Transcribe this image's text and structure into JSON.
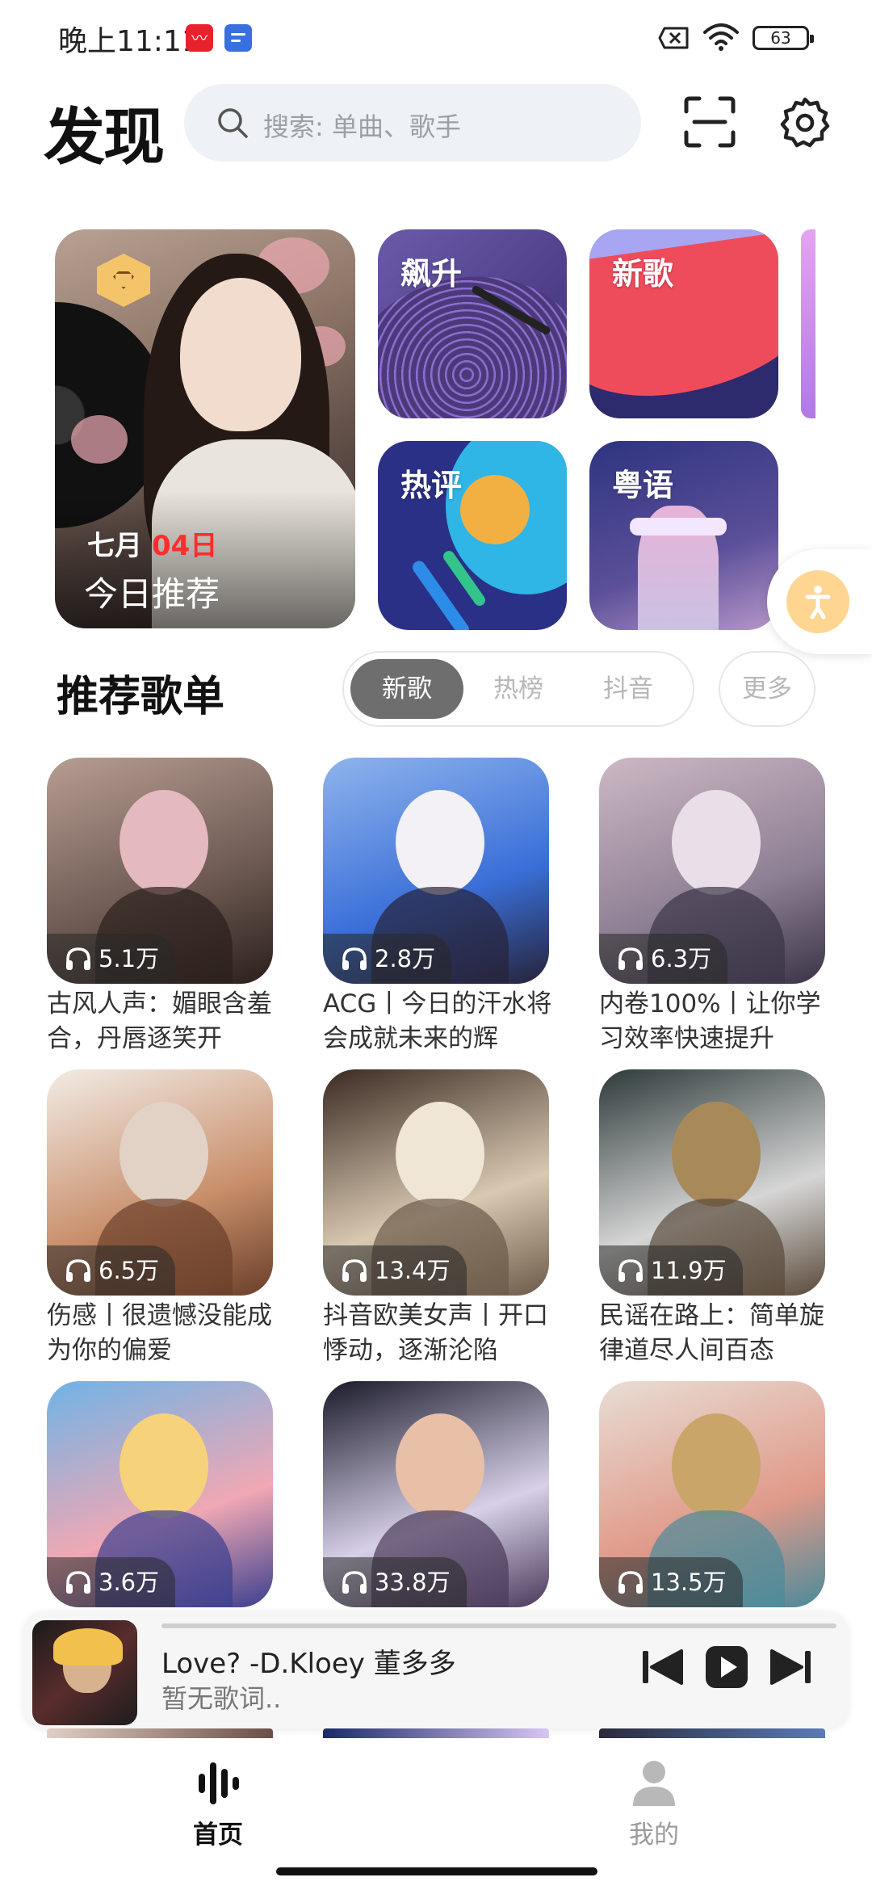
{
  "status_bar": {
    "time": "晚上11:11",
    "battery": "63"
  },
  "header": {
    "title": "发现",
    "search_placeholder": "搜索: 单曲、歌手"
  },
  "banner": {
    "month": "七月",
    "day": "04日",
    "name": "今日推荐"
  },
  "tiles": [
    {
      "label": "飙升"
    },
    {
      "label": "新歌"
    },
    {
      "label": "热评"
    },
    {
      "label": "粤语"
    }
  ],
  "section": {
    "title": "推荐歌单",
    "tabs": [
      "新歌",
      "热榜",
      "抖音"
    ],
    "active_tab": "新歌",
    "more": "更多"
  },
  "playlists": [
    {
      "plays": "5.1万",
      "title": "古风人声：媚眼含羞合，丹唇逐笑开"
    },
    {
      "plays": "2.8万",
      "title": "ACG丨今日的汗水将会成就未来的辉"
    },
    {
      "plays": "6.3万",
      "title": "内卷100%丨让你学习效率快速提升"
    },
    {
      "plays": "6.5万",
      "title": "伤感丨很遗憾没能成为你的偏爱"
    },
    {
      "plays": "13.4万",
      "title": "抖音欧美女声丨开口悸动，逐渐沦陷"
    },
    {
      "plays": "11.9万",
      "title": "民谣在路上：简单旋律道尽人间百态"
    },
    {
      "plays": "3.6万",
      "title": ""
    },
    {
      "plays": "33.8万",
      "title": ""
    },
    {
      "plays": "13.5万",
      "title": ""
    }
  ],
  "player": {
    "song": "Love? -D.Kloey 董多多",
    "lyric": "暂无歌词.."
  },
  "nav": {
    "home": "首页",
    "me": "我的"
  },
  "colors": {
    "accent_red": "#ff2d2d",
    "tab_active": "#6e6e6e",
    "search_bg": "#eef1f5"
  }
}
